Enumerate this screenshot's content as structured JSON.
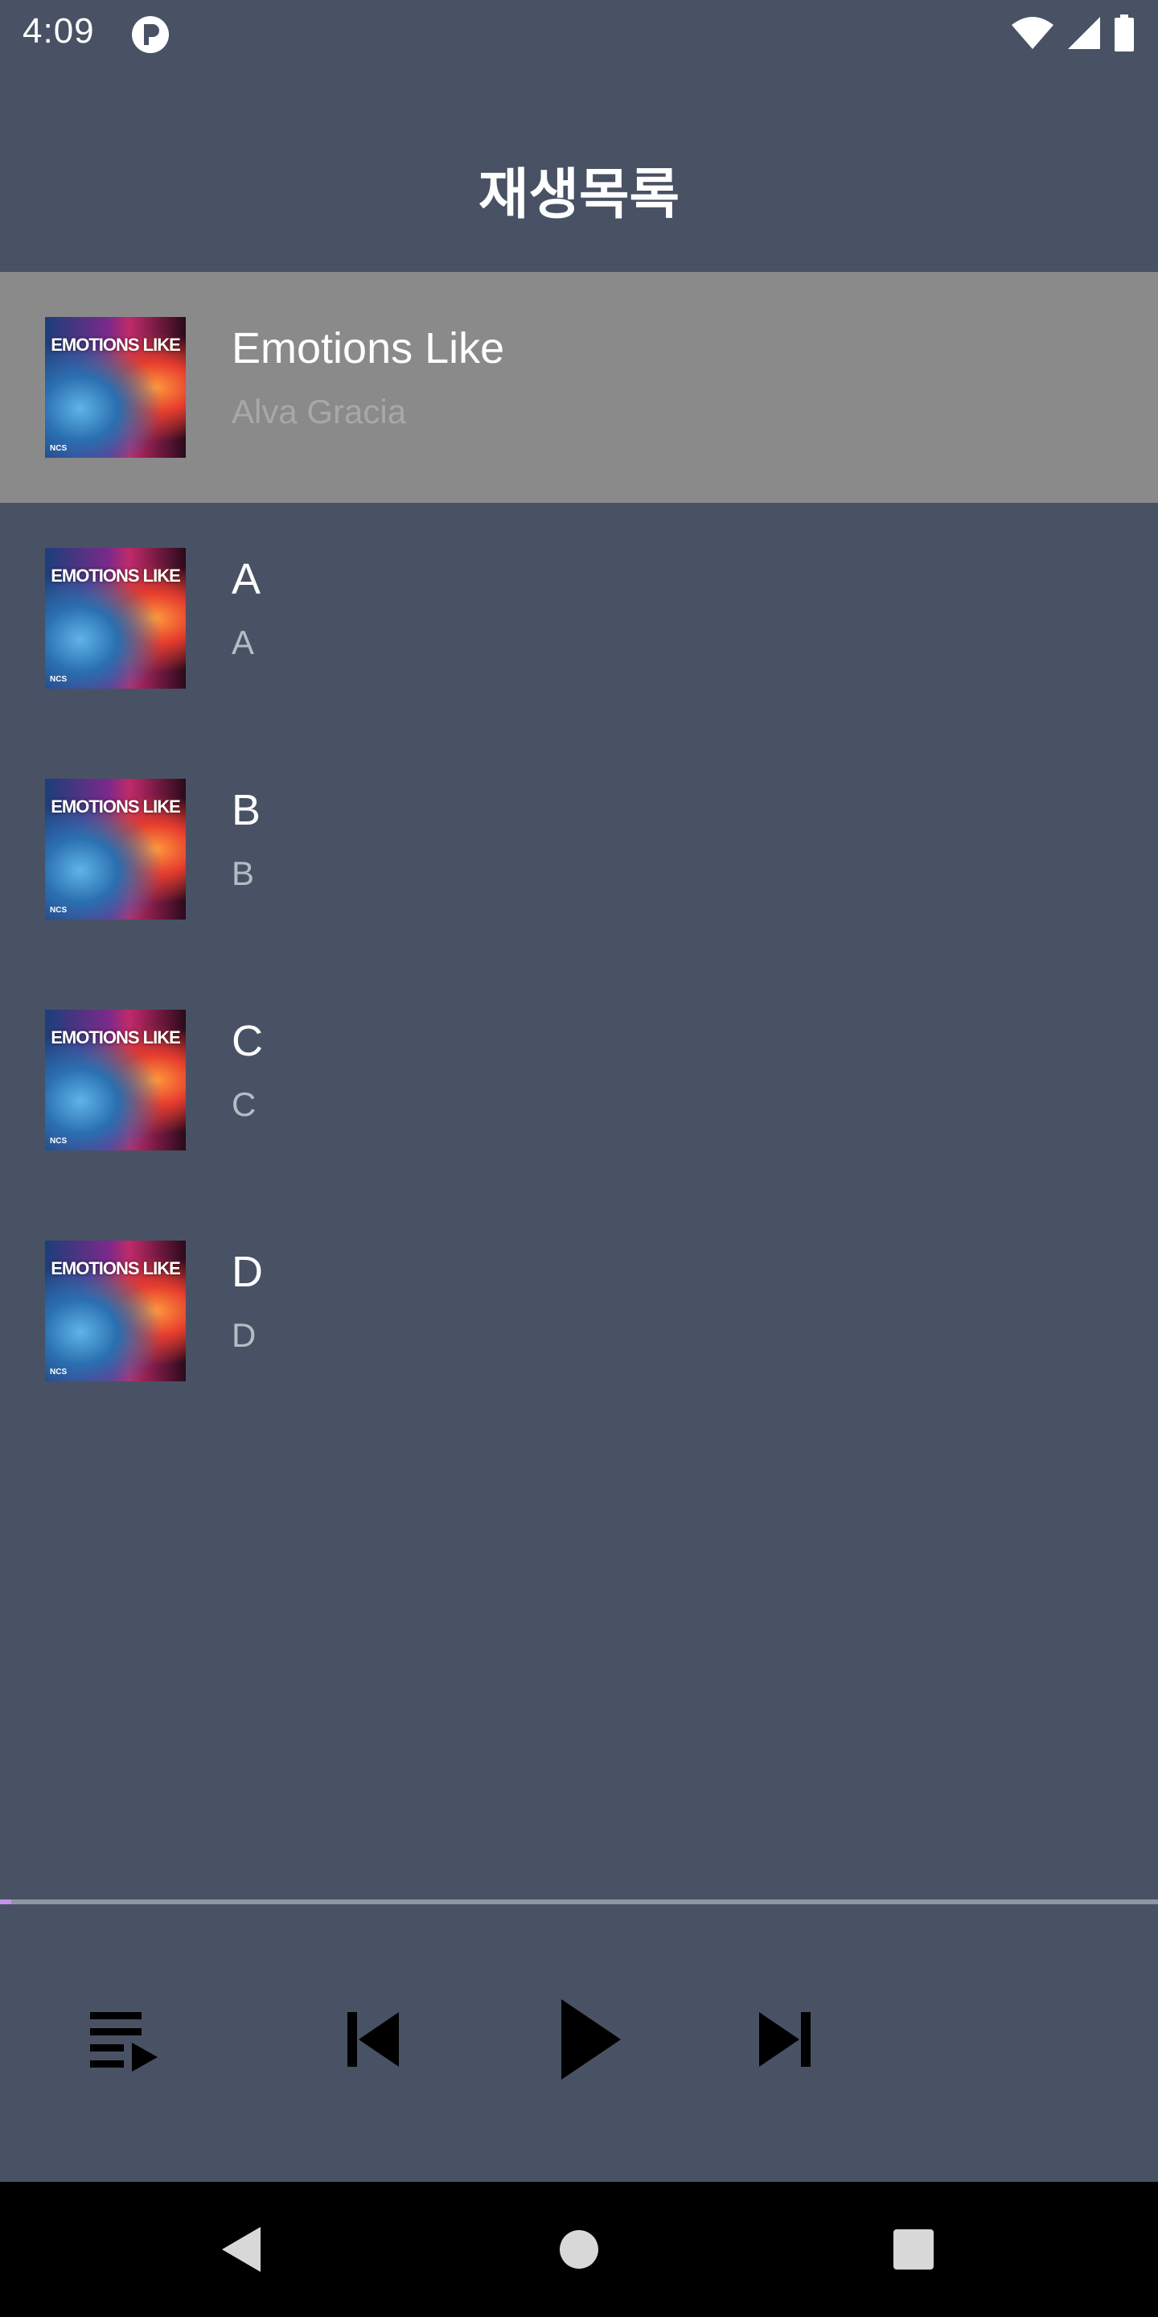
{
  "status": {
    "time": "4:09"
  },
  "header": {
    "title": "재생목록"
  },
  "playlist": {
    "cover_text": "EMOTIONS LIKE",
    "cover_tag": "NCS",
    "tracks": [
      {
        "title": "Emotions Like",
        "artist": "Alva Gracia",
        "active": true
      },
      {
        "title": "A",
        "artist": "A",
        "active": false
      },
      {
        "title": "B",
        "artist": "B",
        "active": false
      },
      {
        "title": "C",
        "artist": "C",
        "active": false
      },
      {
        "title": "D",
        "artist": "D",
        "active": false
      }
    ]
  },
  "player": {
    "progress_fraction": 0.01,
    "accent_color": "#c792ea",
    "icons": [
      "playlist-icon",
      "skip-previous-icon",
      "play-icon",
      "skip-next-icon"
    ]
  },
  "colors": {
    "background": "#485264",
    "active_row": "#8a8a8a",
    "nav_bar": "#000000"
  }
}
